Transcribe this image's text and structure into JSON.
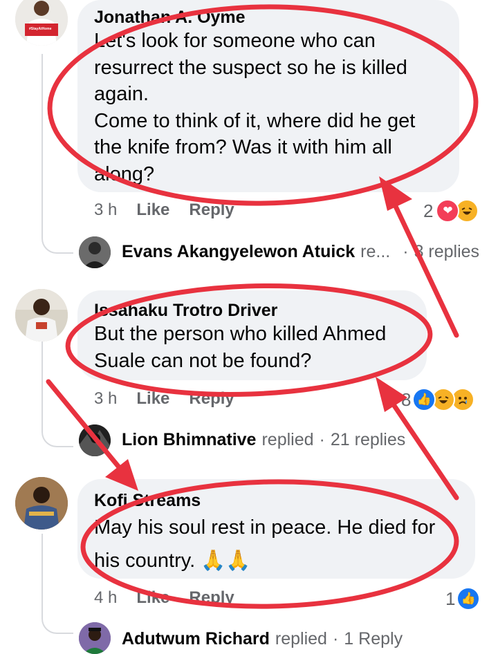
{
  "comments": [
    {
      "author": "Jonathan A. Oyme",
      "avatar_badge": "#StayAtHome",
      "lines": [
        "Let's look for someone who can",
        "resurrect the suspect so he is killed",
        "again.",
        "Come to think of it, where did he get",
        "the knife from? Was it with him all",
        "along?"
      ],
      "time": "3 h",
      "like_label": "Like",
      "reply_label": "Reply",
      "reaction_count": "2",
      "reactions": [
        "love-icon",
        "haha-icon"
      ],
      "reply_author": "Evans Akangyelewon Atuick",
      "reply_suffix": "re...",
      "reply_count": "3 replies"
    },
    {
      "author": "Issahaku Trotro Driver",
      "lines": [
        "But the person who killed Ahmed",
        "Suale can not be found?"
      ],
      "time": "3 h",
      "like_label": "Like",
      "reply_label": "Reply",
      "reaction_count": "8",
      "reactions": [
        "like-icon",
        "haha-icon",
        "sad-icon"
      ],
      "reply_author": "Lion Bhimnative",
      "reply_suffix": "replied",
      "reply_count": "21 replies"
    },
    {
      "author": "Kofi Streams",
      "lines": [
        "May his soul rest in peace. He died for",
        "his country. 🙏🙏"
      ],
      "time": "4 h",
      "like_label": "Like",
      "reply_label": "Reply",
      "reaction_count": "1",
      "reactions": [
        "like-icon"
      ],
      "reply_author": "Adutwum Richard",
      "reply_suffix": "replied",
      "reply_count": "1 Reply"
    }
  ],
  "colors": {
    "bubble": "#f0f2f5",
    "meta_text": "#65676b",
    "annotation_red": "#e8323f",
    "like_blue": "#1877f2",
    "love_red": "#f33e58",
    "haha_yellow": "#f7b125"
  }
}
